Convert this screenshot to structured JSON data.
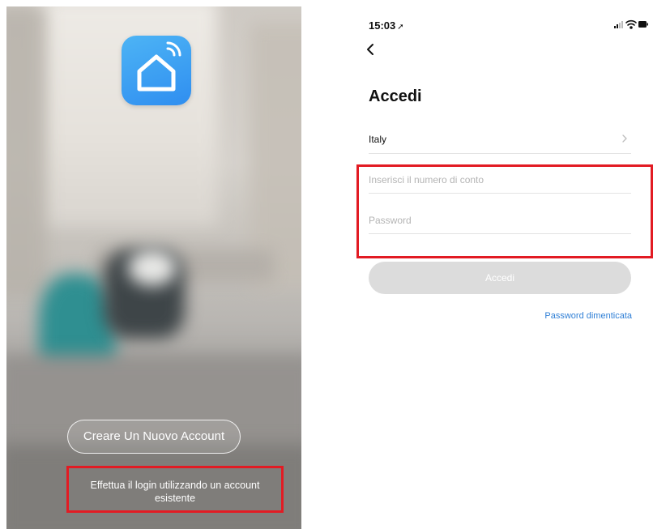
{
  "left_screen": {
    "create_account_label": "Creare Un Nuovo Account",
    "login_existing_label": "Effettua il login utilizzando un account esistente",
    "icons": {
      "app_icon": "home-wifi-icon"
    },
    "colors": {
      "app_icon_bg": "#2f8ef0",
      "highlight": "#e21b23"
    }
  },
  "right_screen": {
    "status_bar": {
      "time": "15:03",
      "location_glyph": "➚",
      "icons": [
        "signal-icon",
        "wifi-icon",
        "battery-icon"
      ]
    },
    "back_icon": "chevron-left-icon",
    "title": "Accedi",
    "country": {
      "value": "Italy",
      "icon": "chevron-right-icon"
    },
    "account_field": {
      "placeholder": "Inserisci il numero di conto",
      "value": ""
    },
    "password_field": {
      "placeholder": "Password",
      "value": ""
    },
    "login_button": {
      "label": "Accedi",
      "state": "disabled"
    },
    "forgot_password_label": "Password dimenticata",
    "colors": {
      "link": "#2f7fd6",
      "button_disabled": "#dcdcdc",
      "highlight": "#e21b23"
    }
  }
}
